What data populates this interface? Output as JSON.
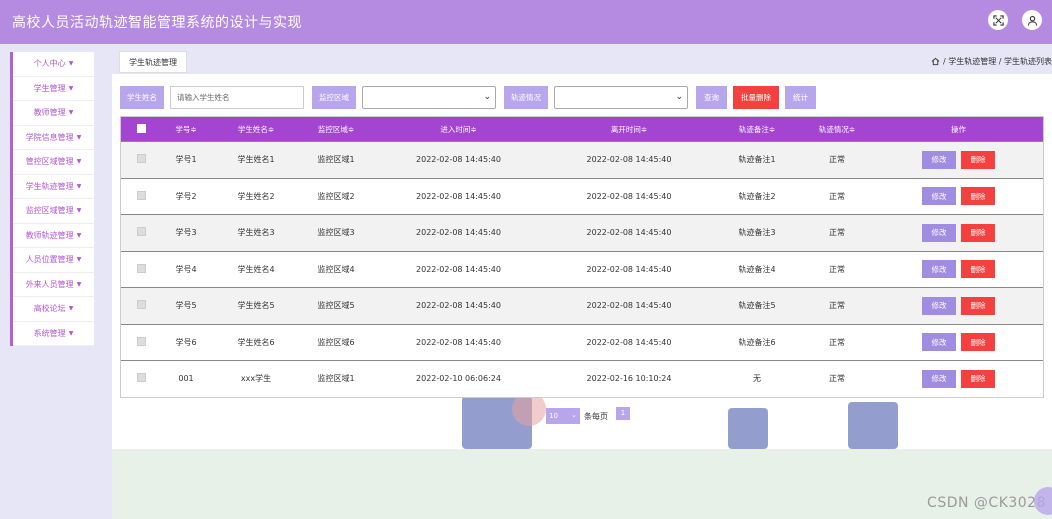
{
  "app": {
    "title": "高校人员活动轨迹智能管理系统的设计与实现"
  },
  "topbar": {
    "icons": [
      "fullscreen-icon",
      "user-icon"
    ]
  },
  "sidebar": {
    "items": [
      {
        "label": "个人中心"
      },
      {
        "label": "学生管理"
      },
      {
        "label": "教师管理"
      },
      {
        "label": "学院信息管理"
      },
      {
        "label": "管控区域管理"
      },
      {
        "label": "学生轨迹管理"
      },
      {
        "label": "监控区域管理"
      },
      {
        "label": "教师轨迹管理"
      },
      {
        "label": "人员位置管理"
      },
      {
        "label": "外来人员管理"
      },
      {
        "label": "高校论坛"
      },
      {
        "label": "系统管理"
      }
    ]
  },
  "breadcrumb": {
    "tab_label": "学生轨迹管理",
    "path": "/ 学生轨迹管理 / 学生轨迹列表"
  },
  "toolbar": {
    "student_name_label": "学生姓名",
    "student_name_placeholder": "请输入学生姓名",
    "monitor_area_label": "监控区域",
    "track_status_label": "轨迹情况",
    "query_label": "查询",
    "batch_delete_label": "批量删除",
    "stats_label": "统计"
  },
  "table": {
    "headers": [
      "学号≑",
      "学生姓名≑",
      "监控区域≑",
      "进入时间≑",
      "离开时间≑",
      "轨迹备注≑",
      "轨迹情况≑",
      "操作"
    ],
    "rows": [
      {
        "id": "学号1",
        "name": "学生姓名1",
        "area": "监控区域1",
        "enter": "2022-02-08 14:45:40",
        "leave": "2022-02-08 14:45:40",
        "note": "轨迹备注1",
        "status": "正常"
      },
      {
        "id": "学号2",
        "name": "学生姓名2",
        "area": "监控区域2",
        "enter": "2022-02-08 14:45:40",
        "leave": "2022-02-08 14:45:40",
        "note": "轨迹备注2",
        "status": "正常"
      },
      {
        "id": "学号3",
        "name": "学生姓名3",
        "area": "监控区域3",
        "enter": "2022-02-08 14:45:40",
        "leave": "2022-02-08 14:45:40",
        "note": "轨迹备注3",
        "status": "正常"
      },
      {
        "id": "学号4",
        "name": "学生姓名4",
        "area": "监控区域4",
        "enter": "2022-02-08 14:45:40",
        "leave": "2022-02-08 14:45:40",
        "note": "轨迹备注4",
        "status": "正常"
      },
      {
        "id": "学号5",
        "name": "学生姓名5",
        "area": "监控区域5",
        "enter": "2022-02-08 14:45:40",
        "leave": "2022-02-08 14:45:40",
        "note": "轨迹备注5",
        "status": "正常"
      },
      {
        "id": "学号6",
        "name": "学生姓名6",
        "area": "监控区域6",
        "enter": "2022-02-08 14:45:40",
        "leave": "2022-02-08 14:45:40",
        "note": "轨迹备注6",
        "status": "正常"
      },
      {
        "id": "001",
        "name": "xxx学生",
        "area": "监控区域1",
        "enter": "2022-02-10 06:06:24",
        "leave": "2022-02-16 10:10:24",
        "note": "无",
        "status": "正常"
      }
    ],
    "edit_label": "修改",
    "delete_label": "删除"
  },
  "pager": {
    "page_size": "10",
    "per_page_label": "条每页",
    "current_page": "1"
  },
  "watermark": "CSDN @CK3028",
  "colors": {
    "header_purple": "#b48be0",
    "table_header": "#a345d1",
    "button_purple": "#b7a6ec",
    "danger_red": "#f4413f",
    "sidebar_text": "#b355d0"
  }
}
